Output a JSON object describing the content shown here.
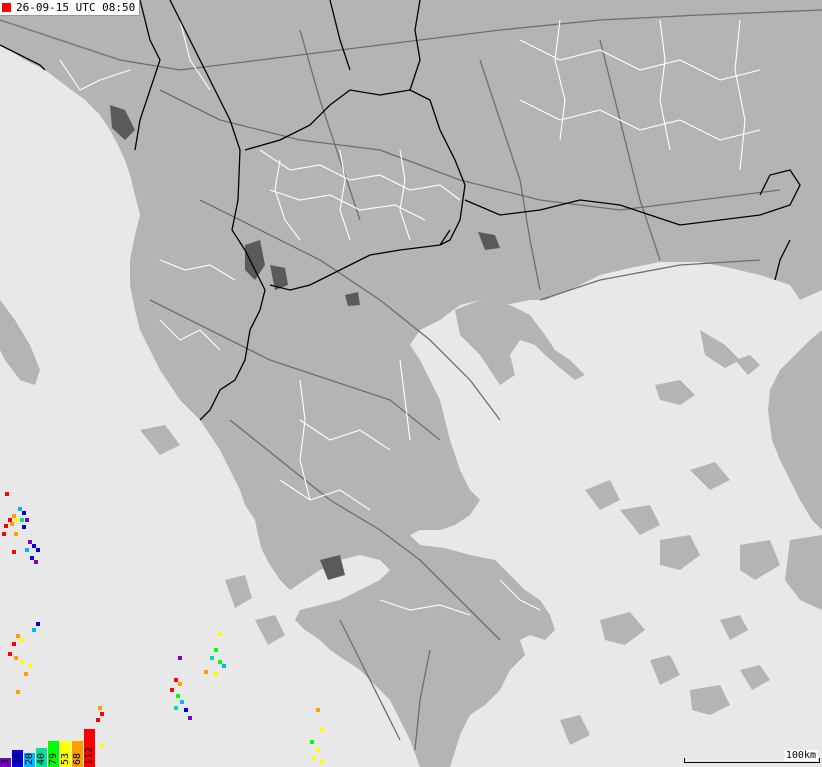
{
  "timestamp": {
    "text": "26-09-15 UTC 08:50",
    "marker_color": "#ff0000"
  },
  "legend": {
    "items": [
      {
        "label": "3",
        "color": "#7a00c8",
        "fill": 0.18
      },
      {
        "label": "34",
        "color": "#0000e0",
        "fill": 0.35
      },
      {
        "label": "20",
        "color": "#00b4ff",
        "fill": 0.3
      },
      {
        "label": "40",
        "color": "#00e0a0",
        "fill": 0.4
      },
      {
        "label": "79",
        "color": "#00ff00",
        "fill": 0.55
      },
      {
        "label": "53",
        "color": "#ffff00",
        "fill": 0.55
      },
      {
        "label": "68",
        "color": "#ffa000",
        "fill": 0.55
      },
      {
        "label": "112",
        "color": "#ff0000",
        "fill": 0.8
      }
    ]
  },
  "scale": {
    "label": "100km"
  },
  "colors": {
    "sea": "#e8e8e8",
    "land": "#b4b4b4",
    "water_body": "#5a5a5a",
    "country_border": "#000000",
    "region_border": "#ffffff",
    "road": "#6e6e6e"
  }
}
